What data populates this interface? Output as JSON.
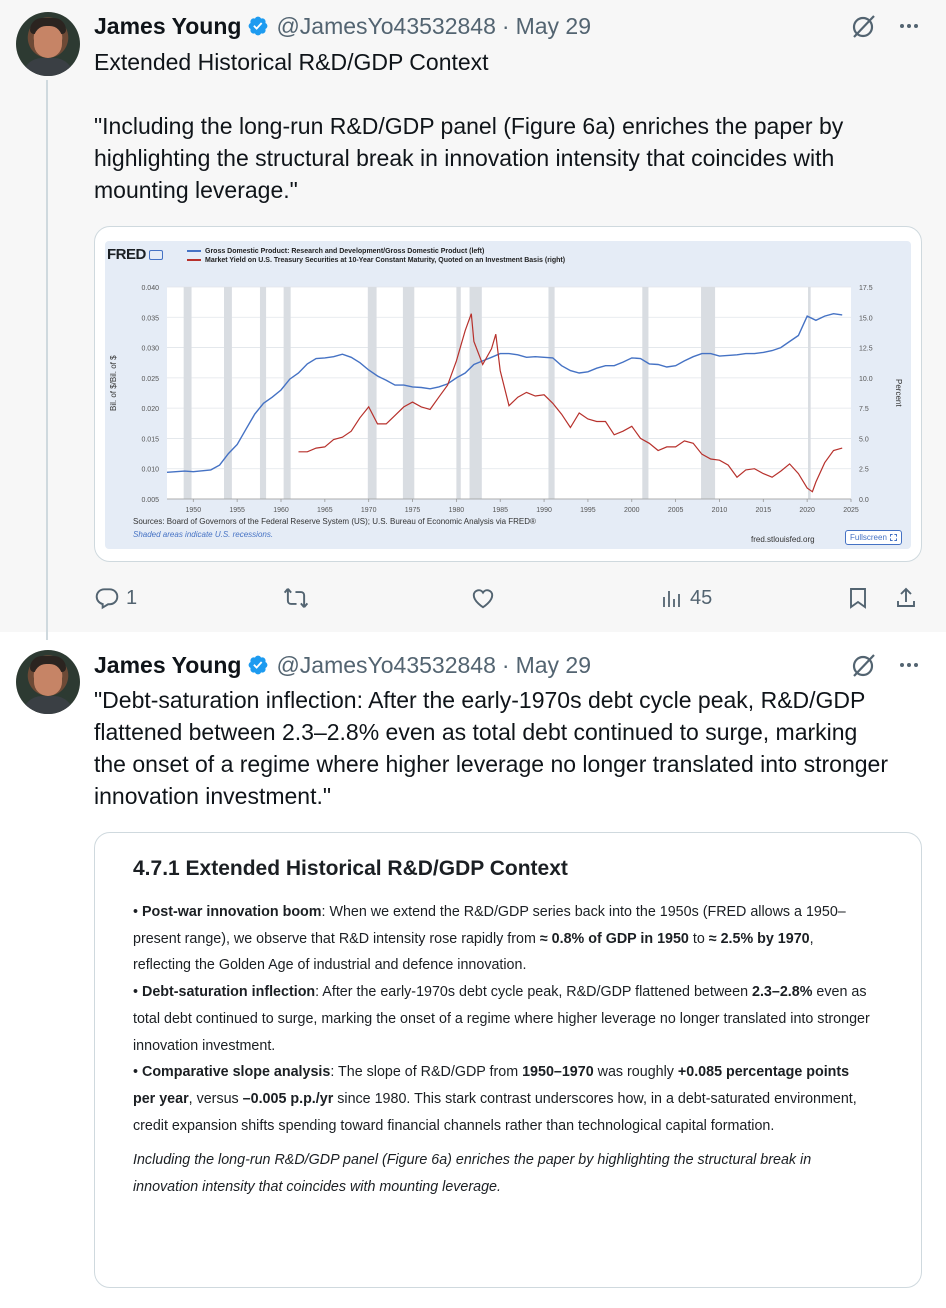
{
  "tweets": [
    {
      "author": "James Young",
      "handle": "@JamesYo43532848",
      "separator": "·",
      "date": "May 29",
      "text_line1": "Extended Historical R&D/GDP Context",
      "text_quote": "\"Including the long-run R&D/GDP panel (Figure 6a) enriches the paper by highlighting the structural break in innovation intensity that coincides with mounting leverage.\"",
      "actions": {
        "replies": "1",
        "views": "45"
      }
    },
    {
      "author": "James Young",
      "handle": "@JamesYo43532848",
      "separator": "·",
      "date": "May 29",
      "text": "\"Debt-saturation inflection: After the early-1970s debt cycle peak, R&D/GDP flattened between 2.3–2.8% even as total debt continued to surge, marking the onset of a regime where higher leverage no longer translated into stronger innovation investment.\""
    }
  ],
  "fred_chart": {
    "logo": "FRED",
    "legend": [
      "Gross Domestic Product: Research and Development/Gross Domestic Product (left)",
      "Market Yield on U.S. Treasury Securities at 10-Year Constant Maturity, Quoted on an Investment Basis (right)"
    ],
    "left_axis_label": "Bil. of $/Bil. of $",
    "right_axis_label": "Percent",
    "sources": "Sources: Board of Governors of the Federal Reserve System (US); U.S. Bureau of Economic Analysis via FRED®",
    "recession_note": "Shaded areas indicate U.S. recessions.",
    "site": "fred.stlouisfed.org",
    "fullscreen": "Fullscreen"
  },
  "chart_data": {
    "type": "line",
    "x_ticks": [
      "1950",
      "1955",
      "1960",
      "1965",
      "1970",
      "1975",
      "1980",
      "1985",
      "1990",
      "1995",
      "2000",
      "2005",
      "2010",
      "2015",
      "2020",
      "2025"
    ],
    "left_ticks": [
      "0.040",
      "0.035",
      "0.030",
      "0.025",
      "0.020",
      "0.015",
      "0.010",
      "0.005"
    ],
    "right_ticks": [
      "17.5",
      "15.0",
      "12.5",
      "10.0",
      "7.5",
      "5.0",
      "2.5",
      "0.0"
    ],
    "xlim": [
      1947,
      2025
    ],
    "ylim_left": [
      0.005,
      0.04
    ],
    "ylim_right": [
      0,
      17.5
    ],
    "recessions": [
      [
        1948.9,
        1949.8
      ],
      [
        1953.5,
        1954.4
      ],
      [
        1957.6,
        1958.3
      ],
      [
        1960.3,
        1961.1
      ],
      [
        1969.9,
        1970.9
      ],
      [
        1973.9,
        1975.2
      ],
      [
        1980.0,
        1980.5
      ],
      [
        1981.5,
        1982.9
      ],
      [
        1990.5,
        1991.2
      ],
      [
        2001.2,
        2001.9
      ],
      [
        2007.9,
        2009.5
      ],
      [
        2020.1,
        2020.4
      ]
    ],
    "series": [
      {
        "name": "Gross Domestic Product: Research and Development/Gross Domestic Product (left)",
        "color": "#4572c4",
        "points": [
          [
            1947,
            0.0094
          ],
          [
            1949,
            0.0096
          ],
          [
            1950,
            0.0095
          ],
          [
            1952,
            0.0098
          ],
          [
            1953,
            0.0106
          ],
          [
            1954,
            0.0125
          ],
          [
            1955,
            0.014
          ],
          [
            1956,
            0.0165
          ],
          [
            1957,
            0.019
          ],
          [
            1958,
            0.0208
          ],
          [
            1959,
            0.0218
          ],
          [
            1960,
            0.023
          ],
          [
            1961,
            0.0248
          ],
          [
            1962,
            0.0258
          ],
          [
            1963,
            0.0273
          ],
          [
            1964,
            0.0282
          ],
          [
            1965,
            0.0283
          ],
          [
            1966,
            0.0285
          ],
          [
            1967,
            0.0289
          ],
          [
            1968,
            0.0284
          ],
          [
            1969,
            0.0275
          ],
          [
            1970,
            0.0263
          ],
          [
            1971,
            0.0253
          ],
          [
            1972,
            0.0246
          ],
          [
            1973,
            0.0238
          ],
          [
            1974,
            0.0238
          ],
          [
            1975,
            0.0235
          ],
          [
            1976,
            0.0234
          ],
          [
            1977,
            0.0232
          ],
          [
            1978,
            0.0235
          ],
          [
            1979,
            0.024
          ],
          [
            1980,
            0.025
          ],
          [
            1981,
            0.0258
          ],
          [
            1982,
            0.0272
          ],
          [
            1983,
            0.0278
          ],
          [
            1984,
            0.0284
          ],
          [
            1985,
            0.029
          ],
          [
            1986,
            0.029
          ],
          [
            1987,
            0.0288
          ],
          [
            1988,
            0.0284
          ],
          [
            1989,
            0.0285
          ],
          [
            1990,
            0.0284
          ],
          [
            1991,
            0.0283
          ],
          [
            1992,
            0.027
          ],
          [
            1993,
            0.0262
          ],
          [
            1994,
            0.0258
          ],
          [
            1995,
            0.026
          ],
          [
            1996,
            0.0266
          ],
          [
            1997,
            0.027
          ],
          [
            1998,
            0.027
          ],
          [
            1999,
            0.0276
          ],
          [
            2000,
            0.0283
          ],
          [
            2001,
            0.0282
          ],
          [
            2002,
            0.0273
          ],
          [
            2003,
            0.0272
          ],
          [
            2004,
            0.0268
          ],
          [
            2005,
            0.027
          ],
          [
            2006,
            0.0278
          ],
          [
            2007,
            0.0285
          ],
          [
            2008,
            0.029
          ],
          [
            2009,
            0.029
          ],
          [
            2010,
            0.0286
          ],
          [
            2011,
            0.0287
          ],
          [
            2012,
            0.0288
          ],
          [
            2013,
            0.029
          ],
          [
            2014,
            0.029
          ],
          [
            2015,
            0.0292
          ],
          [
            2016,
            0.0295
          ],
          [
            2017,
            0.03
          ],
          [
            2018,
            0.031
          ],
          [
            2019,
            0.032
          ],
          [
            2020,
            0.0352
          ],
          [
            2021,
            0.0345
          ],
          [
            2022,
            0.0352
          ],
          [
            2023,
            0.0356
          ],
          [
            2024,
            0.0354
          ]
        ]
      },
      {
        "name": "Market Yield on U.S. Treasury Securities at 10-Year Constant Maturity, Quoted on an Investment Basis (right)",
        "color": "#b7312c",
        "points": [
          [
            1962,
            3.9
          ],
          [
            1963,
            3.9
          ],
          [
            1964,
            4.2
          ],
          [
            1965,
            4.3
          ],
          [
            1966,
            4.9
          ],
          [
            1967,
            5.1
          ],
          [
            1968,
            5.6
          ],
          [
            1969,
            6.7
          ],
          [
            1970,
            7.6
          ],
          [
            1971,
            6.2
          ],
          [
            1972,
            6.2
          ],
          [
            1973,
            6.9
          ],
          [
            1974,
            7.6
          ],
          [
            1975,
            8.0
          ],
          [
            1976,
            7.6
          ],
          [
            1977,
            7.4
          ],
          [
            1978,
            8.4
          ],
          [
            1979,
            9.4
          ],
          [
            1980,
            11.4
          ],
          [
            1981,
            13.9
          ],
          [
            1981.7,
            15.3
          ],
          [
            1982,
            13.0
          ],
          [
            1983,
            11.1
          ],
          [
            1984,
            12.4
          ],
          [
            1984.5,
            13.6
          ],
          [
            1985,
            10.6
          ],
          [
            1986,
            7.7
          ],
          [
            1987,
            8.4
          ],
          [
            1988,
            8.8
          ],
          [
            1989,
            8.5
          ],
          [
            1990,
            8.6
          ],
          [
            1991,
            7.9
          ],
          [
            1992,
            7.0
          ],
          [
            1993,
            5.9
          ],
          [
            1994,
            7.1
          ],
          [
            1995,
            6.6
          ],
          [
            1996,
            6.4
          ],
          [
            1997,
            6.4
          ],
          [
            1998,
            5.3
          ],
          [
            1999,
            5.6
          ],
          [
            2000,
            6.0
          ],
          [
            2001,
            5.0
          ],
          [
            2002,
            4.6
          ],
          [
            2003,
            4.0
          ],
          [
            2004,
            4.3
          ],
          [
            2005,
            4.3
          ],
          [
            2006,
            4.8
          ],
          [
            2007,
            4.6
          ],
          [
            2008,
            3.7
          ],
          [
            2009,
            3.3
          ],
          [
            2010,
            3.2
          ],
          [
            2011,
            2.8
          ],
          [
            2012,
            1.8
          ],
          [
            2013,
            2.4
          ],
          [
            2014,
            2.5
          ],
          [
            2015,
            2.1
          ],
          [
            2016,
            1.8
          ],
          [
            2017,
            2.3
          ],
          [
            2018,
            2.9
          ],
          [
            2019,
            2.1
          ],
          [
            2020,
            0.9
          ],
          [
            2020.6,
            0.6
          ],
          [
            2021,
            1.4
          ],
          [
            2022,
            3.0
          ],
          [
            2023,
            4.0
          ],
          [
            2024,
            4.2
          ]
        ]
      }
    ]
  },
  "doc": {
    "title": "4.7.1 Extended Historical R&D/GDP Context",
    "p1": {
      "bold": "Post-war innovation boom",
      "t1": ": When we extend the R&D/GDP series back into the 1950s (FRED allows a 1950–present range), we observe that R&D intensity rose rapidly from ",
      "b2": "≈ 0.8% of GDP in 1950",
      "t2": " to ",
      "b3": "≈ 2.5% by 1970",
      "t3": ", reflecting the Golden Age of industrial and defence innovation."
    },
    "p2": {
      "bold": "Debt-saturation inflection",
      "t1": ": After the early-1970s debt cycle peak, R&D/GDP flattened between ",
      "b2": "2.3–2.8%",
      "t2": " even as total debt continued to surge, marking the onset of a regime where higher leverage no longer translated into stronger innovation investment."
    },
    "p3": {
      "bold": "Comparative slope analysis",
      "t1": ": The slope of R&D/GDP from ",
      "b2": "1950–1970",
      "t2": " was roughly ",
      "b3": "+0.085 percentage points per year",
      "t3": ", versus ",
      "b4": "–0.005 p.p./yr",
      "t4": " since 1980. This stark contrast underscores how, in a debt-saturated environment, credit expansion shifts spending toward financial channels rather than technological capital formation."
    },
    "italic": "Including the long-run R&D/GDP panel (Figure 6a) enriches the paper by highlighting the structural break in innovation intensity that coincides with mounting leverage.",
    "bullet": "•"
  }
}
